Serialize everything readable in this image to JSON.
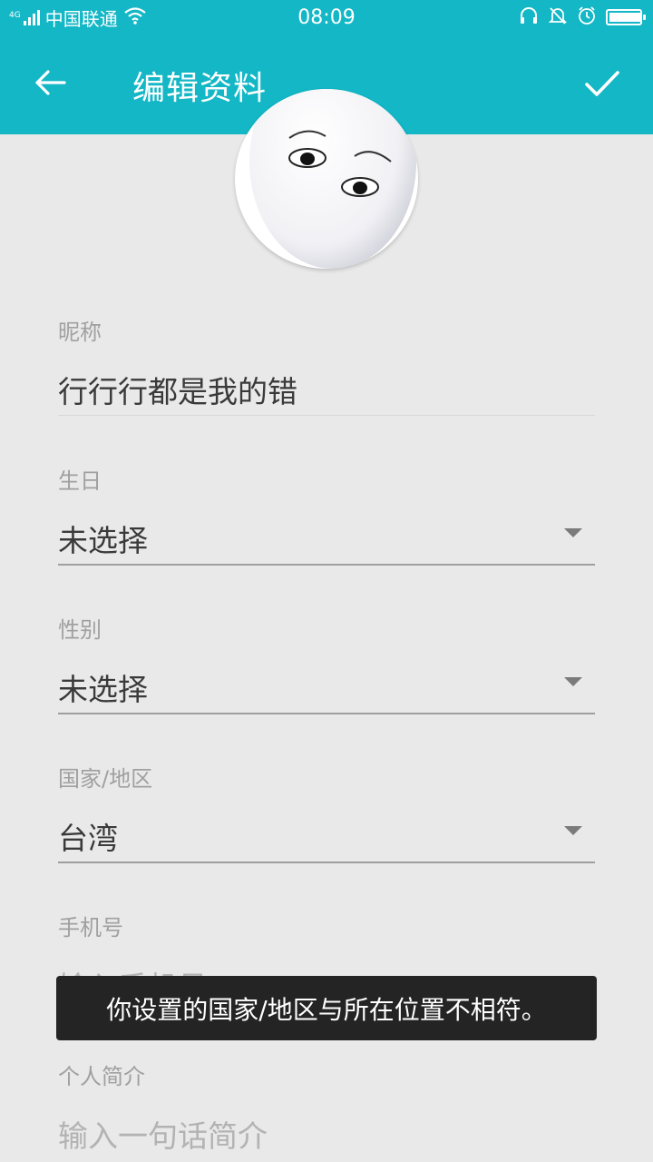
{
  "status_bar": {
    "network_tag": "4G",
    "carrier": "中国联通",
    "time": "08:09",
    "icons": [
      "signal-icon",
      "wifi-icon",
      "headphones-icon",
      "mute-icon",
      "alarm-icon",
      "battery-icon"
    ]
  },
  "app_bar": {
    "title": "编辑资料",
    "back_icon": "arrow-left-icon",
    "confirm_icon": "check-icon",
    "color": "#13b7c6"
  },
  "form": {
    "nickname": {
      "label": "昵称",
      "value": "行行行都是我的错"
    },
    "birthday": {
      "label": "生日",
      "value": "未选择"
    },
    "gender": {
      "label": "性别",
      "value": "未选择"
    },
    "region": {
      "label": "国家/地区",
      "value": "台湾"
    },
    "phone": {
      "label": "手机号",
      "placeholder": "输入手机号"
    },
    "bio": {
      "label": "个人简介",
      "placeholder": "输入一句话简介"
    }
  },
  "toast": {
    "message": "你设置的国家/地区与所在位置不相符。"
  }
}
